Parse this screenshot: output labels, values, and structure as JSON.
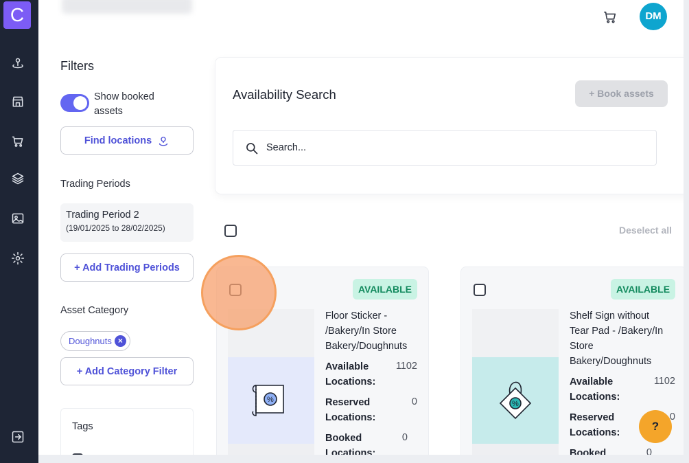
{
  "app": {
    "logo_letter": "C"
  },
  "header": {
    "avatar_initials": "DM"
  },
  "filters": {
    "title": "Filters",
    "show_booked_label": "Show booked assets",
    "show_booked_on": true,
    "find_locations_label": "Find locations",
    "trading_periods_label": "Trading Periods",
    "period": {
      "name": "Trading Period 2",
      "dates": "(19/01/2025 to 28/02/2025)"
    },
    "add_period_label": "+ Add Trading Periods",
    "asset_category_label": "Asset Category",
    "category_chip": "Doughnuts",
    "add_category_label": "+ Add Category Filter",
    "tags_label": "Tags"
  },
  "availability": {
    "title": "Availability Search",
    "book_button": "+ Book assets",
    "search_placeholder": "Search...",
    "deselect_all": "Deselect all"
  },
  "cards": [
    {
      "status": "AVAILABLE",
      "title": "Floor Sticker - /Bakery/In Store Bakery/Doughnuts",
      "available_label": "Available Locations:",
      "available_value": "1102",
      "reserved_label": "Reserved Locations:",
      "reserved_value": "0",
      "booked_label": "Booked Locations:",
      "booked_value": "0",
      "image_bg": "#e4e9fb"
    },
    {
      "status": "AVAILABLE",
      "title": "Shelf Sign without Tear Pad - /Bakery/In Store Bakery/Doughnuts",
      "available_label": "Available Locations:",
      "available_value": "1102",
      "reserved_label": "Reserved Locations:",
      "reserved_value": "0",
      "booked_label": "Booked Locations:",
      "booked_value": "0",
      "image_bg": "#c6ebeb"
    }
  ],
  "help": {
    "label": "?"
  },
  "colors": {
    "accent": "#6366f1",
    "sidebar": "#1e2535",
    "available_bg": "#c9f3e4",
    "help": "#f4a52a"
  }
}
